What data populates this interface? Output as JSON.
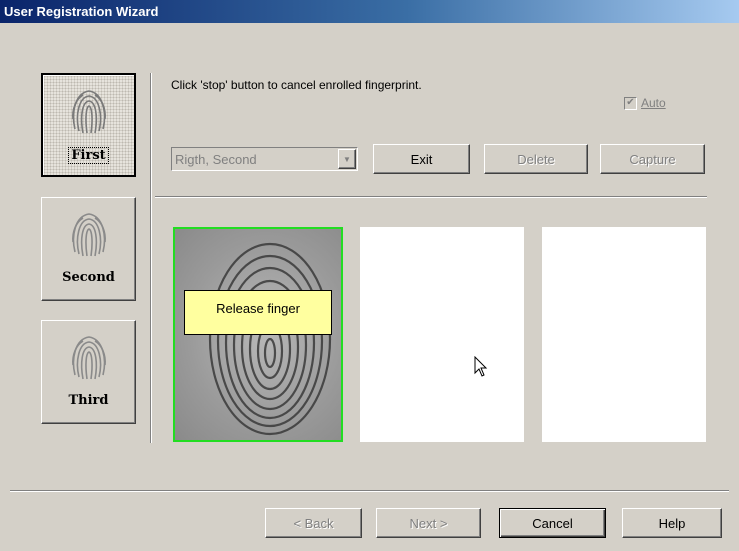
{
  "window": {
    "title": "User Registration Wizard"
  },
  "fingers": [
    {
      "label": "First",
      "active": true
    },
    {
      "label": "Second",
      "active": false
    },
    {
      "label": "Third",
      "active": false
    }
  ],
  "instruction": "Click 'stop' button to cancel enrolled fingerprint.",
  "auto_checkbox": {
    "label": "Auto",
    "checked": true,
    "disabled": true
  },
  "finger_select": {
    "value": "Rigth, Second",
    "disabled": true
  },
  "buttons": {
    "exit": "Exit",
    "delete": "Delete",
    "capture": "Capture"
  },
  "tooltip": "Release finger",
  "nav": {
    "back": "< Back",
    "next": "Next >",
    "cancel": "Cancel",
    "help": "Help"
  },
  "colors": {
    "capture_border": "#22dd22",
    "tooltip_bg": "#ffff9f",
    "window_bg": "#d4d0c8"
  }
}
